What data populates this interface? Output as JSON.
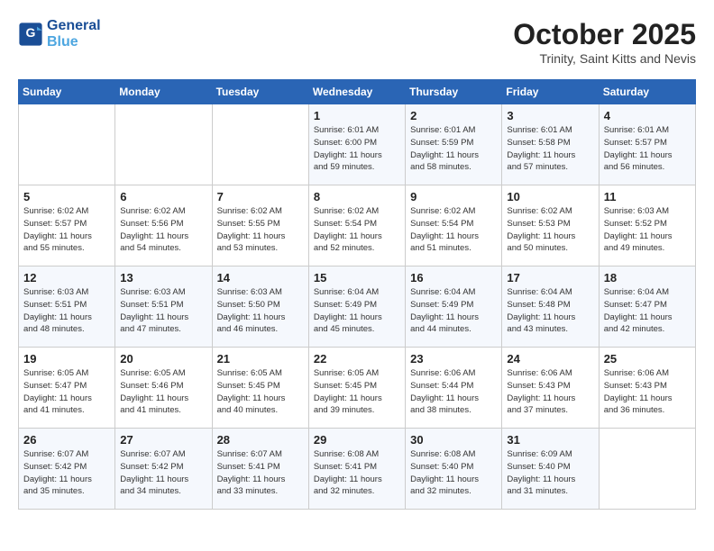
{
  "header": {
    "logo_line1": "General",
    "logo_line2": "Blue",
    "month": "October 2025",
    "location": "Trinity, Saint Kitts and Nevis"
  },
  "days_of_week": [
    "Sunday",
    "Monday",
    "Tuesday",
    "Wednesday",
    "Thursday",
    "Friday",
    "Saturday"
  ],
  "weeks": [
    [
      {
        "day": "",
        "info": ""
      },
      {
        "day": "",
        "info": ""
      },
      {
        "day": "",
        "info": ""
      },
      {
        "day": "1",
        "info": "Sunrise: 6:01 AM\nSunset: 6:00 PM\nDaylight: 11 hours\nand 59 minutes."
      },
      {
        "day": "2",
        "info": "Sunrise: 6:01 AM\nSunset: 5:59 PM\nDaylight: 11 hours\nand 58 minutes."
      },
      {
        "day": "3",
        "info": "Sunrise: 6:01 AM\nSunset: 5:58 PM\nDaylight: 11 hours\nand 57 minutes."
      },
      {
        "day": "4",
        "info": "Sunrise: 6:01 AM\nSunset: 5:57 PM\nDaylight: 11 hours\nand 56 minutes."
      }
    ],
    [
      {
        "day": "5",
        "info": "Sunrise: 6:02 AM\nSunset: 5:57 PM\nDaylight: 11 hours\nand 55 minutes."
      },
      {
        "day": "6",
        "info": "Sunrise: 6:02 AM\nSunset: 5:56 PM\nDaylight: 11 hours\nand 54 minutes."
      },
      {
        "day": "7",
        "info": "Sunrise: 6:02 AM\nSunset: 5:55 PM\nDaylight: 11 hours\nand 53 minutes."
      },
      {
        "day": "8",
        "info": "Sunrise: 6:02 AM\nSunset: 5:54 PM\nDaylight: 11 hours\nand 52 minutes."
      },
      {
        "day": "9",
        "info": "Sunrise: 6:02 AM\nSunset: 5:54 PM\nDaylight: 11 hours\nand 51 minutes."
      },
      {
        "day": "10",
        "info": "Sunrise: 6:02 AM\nSunset: 5:53 PM\nDaylight: 11 hours\nand 50 minutes."
      },
      {
        "day": "11",
        "info": "Sunrise: 6:03 AM\nSunset: 5:52 PM\nDaylight: 11 hours\nand 49 minutes."
      }
    ],
    [
      {
        "day": "12",
        "info": "Sunrise: 6:03 AM\nSunset: 5:51 PM\nDaylight: 11 hours\nand 48 minutes."
      },
      {
        "day": "13",
        "info": "Sunrise: 6:03 AM\nSunset: 5:51 PM\nDaylight: 11 hours\nand 47 minutes."
      },
      {
        "day": "14",
        "info": "Sunrise: 6:03 AM\nSunset: 5:50 PM\nDaylight: 11 hours\nand 46 minutes."
      },
      {
        "day": "15",
        "info": "Sunrise: 6:04 AM\nSunset: 5:49 PM\nDaylight: 11 hours\nand 45 minutes."
      },
      {
        "day": "16",
        "info": "Sunrise: 6:04 AM\nSunset: 5:49 PM\nDaylight: 11 hours\nand 44 minutes."
      },
      {
        "day": "17",
        "info": "Sunrise: 6:04 AM\nSunset: 5:48 PM\nDaylight: 11 hours\nand 43 minutes."
      },
      {
        "day": "18",
        "info": "Sunrise: 6:04 AM\nSunset: 5:47 PM\nDaylight: 11 hours\nand 42 minutes."
      }
    ],
    [
      {
        "day": "19",
        "info": "Sunrise: 6:05 AM\nSunset: 5:47 PM\nDaylight: 11 hours\nand 41 minutes."
      },
      {
        "day": "20",
        "info": "Sunrise: 6:05 AM\nSunset: 5:46 PM\nDaylight: 11 hours\nand 41 minutes."
      },
      {
        "day": "21",
        "info": "Sunrise: 6:05 AM\nSunset: 5:45 PM\nDaylight: 11 hours\nand 40 minutes."
      },
      {
        "day": "22",
        "info": "Sunrise: 6:05 AM\nSunset: 5:45 PM\nDaylight: 11 hours\nand 39 minutes."
      },
      {
        "day": "23",
        "info": "Sunrise: 6:06 AM\nSunset: 5:44 PM\nDaylight: 11 hours\nand 38 minutes."
      },
      {
        "day": "24",
        "info": "Sunrise: 6:06 AM\nSunset: 5:43 PM\nDaylight: 11 hours\nand 37 minutes."
      },
      {
        "day": "25",
        "info": "Sunrise: 6:06 AM\nSunset: 5:43 PM\nDaylight: 11 hours\nand 36 minutes."
      }
    ],
    [
      {
        "day": "26",
        "info": "Sunrise: 6:07 AM\nSunset: 5:42 PM\nDaylight: 11 hours\nand 35 minutes."
      },
      {
        "day": "27",
        "info": "Sunrise: 6:07 AM\nSunset: 5:42 PM\nDaylight: 11 hours\nand 34 minutes."
      },
      {
        "day": "28",
        "info": "Sunrise: 6:07 AM\nSunset: 5:41 PM\nDaylight: 11 hours\nand 33 minutes."
      },
      {
        "day": "29",
        "info": "Sunrise: 6:08 AM\nSunset: 5:41 PM\nDaylight: 11 hours\nand 32 minutes."
      },
      {
        "day": "30",
        "info": "Sunrise: 6:08 AM\nSunset: 5:40 PM\nDaylight: 11 hours\nand 32 minutes."
      },
      {
        "day": "31",
        "info": "Sunrise: 6:09 AM\nSunset: 5:40 PM\nDaylight: 11 hours\nand 31 minutes."
      },
      {
        "day": "",
        "info": ""
      }
    ]
  ]
}
